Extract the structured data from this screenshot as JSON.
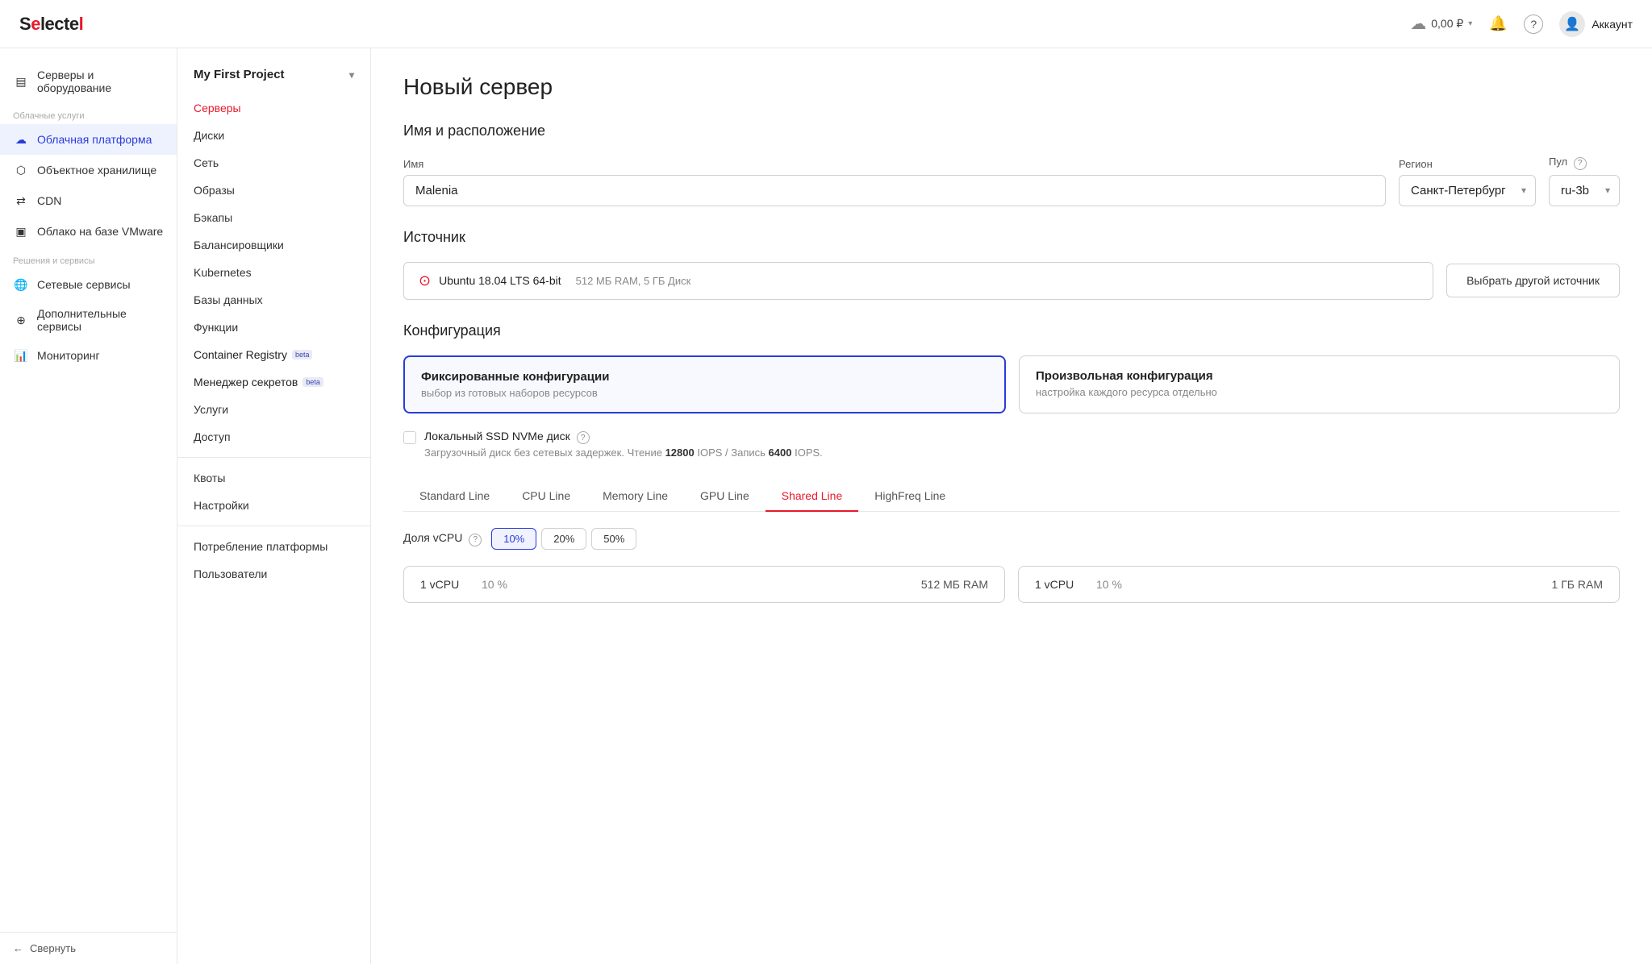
{
  "header": {
    "logo": "Selectel",
    "balance": "0,00 ₽",
    "account_label": "Аккаунт"
  },
  "sidebar_left": {
    "items": [
      {
        "id": "servers",
        "label": "Серверы и оборудование",
        "icon": "▤"
      },
      {
        "id": "cloud-section-label",
        "label": "Облачные услуги",
        "type": "label"
      },
      {
        "id": "cloud",
        "label": "Облачная платформа",
        "icon": "☁",
        "active": true
      },
      {
        "id": "object",
        "label": "Объектное хранилище",
        "icon": "⬡"
      },
      {
        "id": "cdn",
        "label": "CDN",
        "icon": "⇄"
      },
      {
        "id": "vmware",
        "label": "Облако на базе VMware",
        "icon": "▣"
      },
      {
        "id": "solutions-label",
        "label": "Решения и сервисы",
        "type": "label"
      },
      {
        "id": "network",
        "label": "Сетевые сервисы",
        "icon": "🌐"
      },
      {
        "id": "extra",
        "label": "Дополнительные сервисы",
        "icon": "＋"
      },
      {
        "id": "monitoring",
        "label": "Мониторинг",
        "icon": "📊"
      }
    ],
    "collapse_label": "Свернуть"
  },
  "sidebar_mid": {
    "project_name": "My First Project",
    "nav_items": [
      {
        "id": "servers",
        "label": "Серверы",
        "active": true
      },
      {
        "id": "disks",
        "label": "Диски"
      },
      {
        "id": "network",
        "label": "Сеть"
      },
      {
        "id": "images",
        "label": "Образы"
      },
      {
        "id": "backups",
        "label": "Бэкапы"
      },
      {
        "id": "balancers",
        "label": "Балансировщики"
      },
      {
        "id": "kubernetes",
        "label": "Kubernetes"
      },
      {
        "id": "databases",
        "label": "Базы данных"
      },
      {
        "id": "functions",
        "label": "Функции"
      },
      {
        "id": "container-registry",
        "label": "Container Registry",
        "badge": "beta"
      },
      {
        "id": "secrets",
        "label": "Менеджер секретов",
        "badge": "beta"
      },
      {
        "id": "services",
        "label": "Услуги"
      },
      {
        "id": "access",
        "label": "Доступ"
      }
    ],
    "bottom_items": [
      {
        "id": "quotas",
        "label": "Квоты"
      },
      {
        "id": "settings",
        "label": "Настройки"
      }
    ],
    "divider_items": [
      {
        "id": "platform-usage",
        "label": "Потребление платформы"
      },
      {
        "id": "users",
        "label": "Пользователи"
      }
    ]
  },
  "main": {
    "page_title": "Новый сервер",
    "section_name_location": "Имя и расположение",
    "name_label": "Имя",
    "name_value": "Malenia",
    "region_label": "Регион",
    "region_value": "Санкт-Петербург",
    "pool_label": "Пул",
    "pool_value": "ru-3b",
    "source_section": "Источник",
    "source_name": "Ubuntu 18.04 LTS 64-bit",
    "source_meta": "512 МБ RAM, 5 ГБ Диск",
    "source_change_btn": "Выбрать другой источник",
    "config_section": "Конфигурация",
    "config_fixed_title": "Фиксированные конфигурации",
    "config_fixed_desc": "выбор из готовых наборов ресурсов",
    "config_custom_title": "Произвольная конфигурация",
    "config_custom_desc": "настройка каждого ресурса отдельно",
    "checkbox_label": "Локальный SSD NVMe диск",
    "checkbox_sub": "Загрузочный диск без сетевых задержек. Чтение",
    "checkbox_sub_read": "12800",
    "checkbox_sub_iops1": "IOPS / Запись",
    "checkbox_sub_write": "6400",
    "checkbox_sub_iops2": "IOPS.",
    "tabs": [
      {
        "id": "standard",
        "label": "Standard Line"
      },
      {
        "id": "cpu",
        "label": "CPU Line"
      },
      {
        "id": "memory",
        "label": "Memory Line"
      },
      {
        "id": "gpu",
        "label": "GPU Line"
      },
      {
        "id": "shared",
        "label": "Shared Line",
        "active": true
      },
      {
        "id": "highfreq",
        "label": "HighFreq Line"
      }
    ],
    "vcpu_label": "Доля vCPU",
    "vcpu_options": [
      {
        "value": "10%",
        "active": true
      },
      {
        "value": "20%"
      },
      {
        "value": "50%"
      }
    ],
    "server_configs": [
      {
        "cpu": "1 vCPU",
        "pct": "10 %",
        "ram": "512 МБ RAM"
      },
      {
        "cpu": "1 vCPU",
        "pct": "10 %",
        "ram": "1 ГБ RAM"
      }
    ]
  }
}
